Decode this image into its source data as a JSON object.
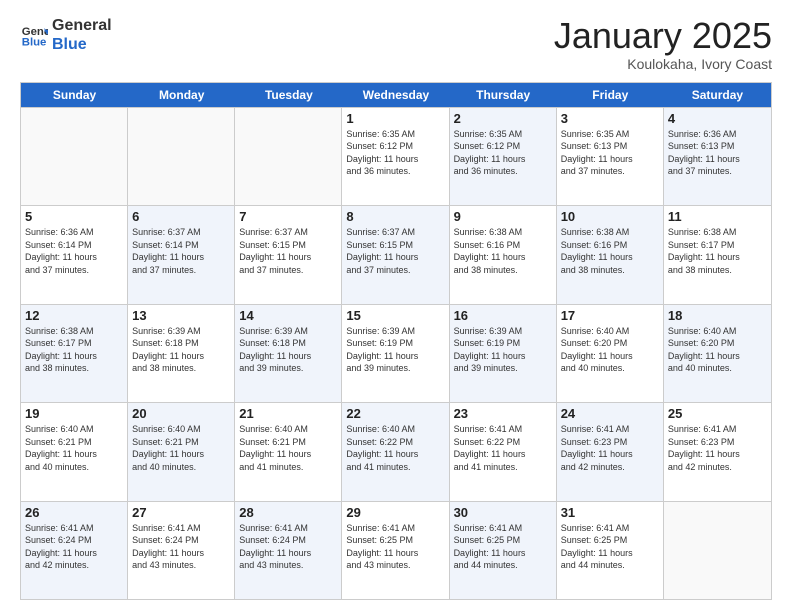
{
  "header": {
    "logo_general": "General",
    "logo_blue": "Blue",
    "title": "January 2025",
    "location": "Koulokaha, Ivory Coast"
  },
  "weekdays": [
    "Sunday",
    "Monday",
    "Tuesday",
    "Wednesday",
    "Thursday",
    "Friday",
    "Saturday"
  ],
  "weeks": [
    [
      {
        "day": "",
        "info": "",
        "empty": true
      },
      {
        "day": "",
        "info": "",
        "empty": true
      },
      {
        "day": "",
        "info": "",
        "empty": true
      },
      {
        "day": "1",
        "info": "Sunrise: 6:35 AM\nSunset: 6:12 PM\nDaylight: 11 hours\nand 36 minutes.",
        "empty": false,
        "alt": false
      },
      {
        "day": "2",
        "info": "Sunrise: 6:35 AM\nSunset: 6:12 PM\nDaylight: 11 hours\nand 36 minutes.",
        "empty": false,
        "alt": true
      },
      {
        "day": "3",
        "info": "Sunrise: 6:35 AM\nSunset: 6:13 PM\nDaylight: 11 hours\nand 37 minutes.",
        "empty": false,
        "alt": false
      },
      {
        "day": "4",
        "info": "Sunrise: 6:36 AM\nSunset: 6:13 PM\nDaylight: 11 hours\nand 37 minutes.",
        "empty": false,
        "alt": true
      }
    ],
    [
      {
        "day": "5",
        "info": "Sunrise: 6:36 AM\nSunset: 6:14 PM\nDaylight: 11 hours\nand 37 minutes.",
        "empty": false,
        "alt": false
      },
      {
        "day": "6",
        "info": "Sunrise: 6:37 AM\nSunset: 6:14 PM\nDaylight: 11 hours\nand 37 minutes.",
        "empty": false,
        "alt": true
      },
      {
        "day": "7",
        "info": "Sunrise: 6:37 AM\nSunset: 6:15 PM\nDaylight: 11 hours\nand 37 minutes.",
        "empty": false,
        "alt": false
      },
      {
        "day": "8",
        "info": "Sunrise: 6:37 AM\nSunset: 6:15 PM\nDaylight: 11 hours\nand 37 minutes.",
        "empty": false,
        "alt": true
      },
      {
        "day": "9",
        "info": "Sunrise: 6:38 AM\nSunset: 6:16 PM\nDaylight: 11 hours\nand 38 minutes.",
        "empty": false,
        "alt": false
      },
      {
        "day": "10",
        "info": "Sunrise: 6:38 AM\nSunset: 6:16 PM\nDaylight: 11 hours\nand 38 minutes.",
        "empty": false,
        "alt": true
      },
      {
        "day": "11",
        "info": "Sunrise: 6:38 AM\nSunset: 6:17 PM\nDaylight: 11 hours\nand 38 minutes.",
        "empty": false,
        "alt": false
      }
    ],
    [
      {
        "day": "12",
        "info": "Sunrise: 6:38 AM\nSunset: 6:17 PM\nDaylight: 11 hours\nand 38 minutes.",
        "empty": false,
        "alt": true
      },
      {
        "day": "13",
        "info": "Sunrise: 6:39 AM\nSunset: 6:18 PM\nDaylight: 11 hours\nand 38 minutes.",
        "empty": false,
        "alt": false
      },
      {
        "day": "14",
        "info": "Sunrise: 6:39 AM\nSunset: 6:18 PM\nDaylight: 11 hours\nand 39 minutes.",
        "empty": false,
        "alt": true
      },
      {
        "day": "15",
        "info": "Sunrise: 6:39 AM\nSunset: 6:19 PM\nDaylight: 11 hours\nand 39 minutes.",
        "empty": false,
        "alt": false
      },
      {
        "day": "16",
        "info": "Sunrise: 6:39 AM\nSunset: 6:19 PM\nDaylight: 11 hours\nand 39 minutes.",
        "empty": false,
        "alt": true
      },
      {
        "day": "17",
        "info": "Sunrise: 6:40 AM\nSunset: 6:20 PM\nDaylight: 11 hours\nand 40 minutes.",
        "empty": false,
        "alt": false
      },
      {
        "day": "18",
        "info": "Sunrise: 6:40 AM\nSunset: 6:20 PM\nDaylight: 11 hours\nand 40 minutes.",
        "empty": false,
        "alt": true
      }
    ],
    [
      {
        "day": "19",
        "info": "Sunrise: 6:40 AM\nSunset: 6:21 PM\nDaylight: 11 hours\nand 40 minutes.",
        "empty": false,
        "alt": false
      },
      {
        "day": "20",
        "info": "Sunrise: 6:40 AM\nSunset: 6:21 PM\nDaylight: 11 hours\nand 40 minutes.",
        "empty": false,
        "alt": true
      },
      {
        "day": "21",
        "info": "Sunrise: 6:40 AM\nSunset: 6:21 PM\nDaylight: 11 hours\nand 41 minutes.",
        "empty": false,
        "alt": false
      },
      {
        "day": "22",
        "info": "Sunrise: 6:40 AM\nSunset: 6:22 PM\nDaylight: 11 hours\nand 41 minutes.",
        "empty": false,
        "alt": true
      },
      {
        "day": "23",
        "info": "Sunrise: 6:41 AM\nSunset: 6:22 PM\nDaylight: 11 hours\nand 41 minutes.",
        "empty": false,
        "alt": false
      },
      {
        "day": "24",
        "info": "Sunrise: 6:41 AM\nSunset: 6:23 PM\nDaylight: 11 hours\nand 42 minutes.",
        "empty": false,
        "alt": true
      },
      {
        "day": "25",
        "info": "Sunrise: 6:41 AM\nSunset: 6:23 PM\nDaylight: 11 hours\nand 42 minutes.",
        "empty": false,
        "alt": false
      }
    ],
    [
      {
        "day": "26",
        "info": "Sunrise: 6:41 AM\nSunset: 6:24 PM\nDaylight: 11 hours\nand 42 minutes.",
        "empty": false,
        "alt": true
      },
      {
        "day": "27",
        "info": "Sunrise: 6:41 AM\nSunset: 6:24 PM\nDaylight: 11 hours\nand 43 minutes.",
        "empty": false,
        "alt": false
      },
      {
        "day": "28",
        "info": "Sunrise: 6:41 AM\nSunset: 6:24 PM\nDaylight: 11 hours\nand 43 minutes.",
        "empty": false,
        "alt": true
      },
      {
        "day": "29",
        "info": "Sunrise: 6:41 AM\nSunset: 6:25 PM\nDaylight: 11 hours\nand 43 minutes.",
        "empty": false,
        "alt": false
      },
      {
        "day": "30",
        "info": "Sunrise: 6:41 AM\nSunset: 6:25 PM\nDaylight: 11 hours\nand 44 minutes.",
        "empty": false,
        "alt": true
      },
      {
        "day": "31",
        "info": "Sunrise: 6:41 AM\nSunset: 6:25 PM\nDaylight: 11 hours\nand 44 minutes.",
        "empty": false,
        "alt": false
      },
      {
        "day": "",
        "info": "",
        "empty": true,
        "alt": false
      }
    ]
  ]
}
